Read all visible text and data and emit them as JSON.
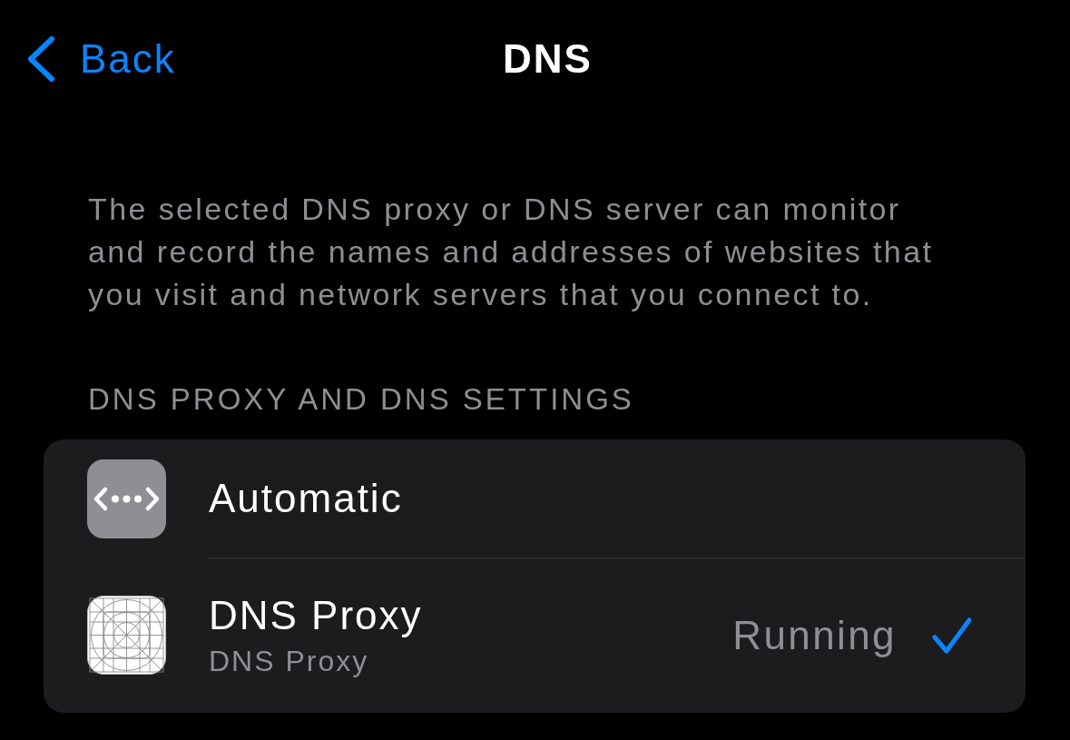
{
  "nav": {
    "back_label": "Back",
    "title": "DNS"
  },
  "description": "The selected DNS proxy or DNS server can monitor and record the names and addresses of websites that you visit and network servers that you connect to.",
  "section_header": "DNS PROXY AND DNS SETTINGS",
  "options": [
    {
      "kind": "automatic",
      "title": "Automatic",
      "selected": false
    },
    {
      "kind": "app",
      "title": "DNS Proxy",
      "subtitle": "DNS Proxy",
      "status": "Running",
      "selected": true
    }
  ]
}
